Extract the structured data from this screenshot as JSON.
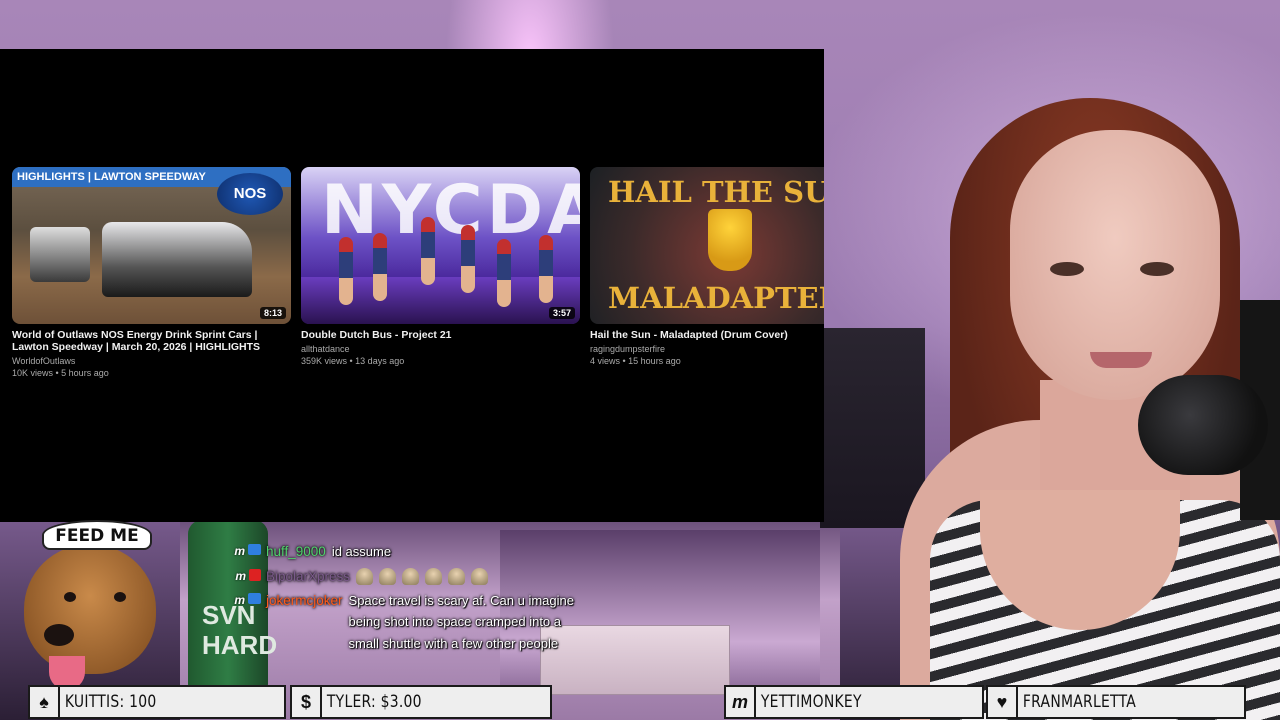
{
  "videos": [
    {
      "thumb_banner": "HIGHLIGHTS | LAWTON SPEEDWAY",
      "thumb_logo": "NOS",
      "duration": "8:13",
      "title": "World of Outlaws NOS Energy Drink Sprint Cars | Lawton Speedway | March 20, 2026 | HIGHLIGHTS",
      "channel": "WorldofOutlaws",
      "meta": "10K views • 5 hours ago"
    },
    {
      "thumb_text": "NYCDA",
      "duration": "3:57",
      "title": "Double Dutch Bus - Project 21",
      "channel": "allthatdance",
      "meta": "359K views • 13 days ago"
    },
    {
      "thumb_top": "HAIL THE SUN",
      "thumb_bottom": "MALADAPTED",
      "title": "Hail the Sun - Maladapted (Drum Cover)",
      "channel": "ragingdumpsterfire",
      "meta": "4 views • 15 hours ago"
    }
  ],
  "sticker": {
    "text": "FEED ME"
  },
  "chat": [
    {
      "user": "huff_9000",
      "user_color": "#4fd16b",
      "message": "id assume"
    },
    {
      "user": "BipolarXpress",
      "user_color": "#7a5a8a",
      "message": ""
    },
    {
      "user": "jokermcjoker",
      "user_color": "#ff5a1a",
      "message": "Space travel is scary af. Can u imagine being shot into space cramped into a small shuttle with a few other people"
    }
  ],
  "background": {
    "can_text": "SVN HARD"
  },
  "bottom_bar": [
    {
      "icon": "♠",
      "icon_name": "spade-icon",
      "label": "KUITTIS: 100"
    },
    {
      "icon": "$",
      "icon_name": "dollar-icon",
      "label": "TYLER: $3.00"
    },
    {
      "icon": "m",
      "icon_name": "membership-m-icon",
      "label": "YETTIMONKEY"
    },
    {
      "icon": "♥",
      "icon_name": "heart-icon",
      "label": "FRANMARLETTA"
    }
  ]
}
